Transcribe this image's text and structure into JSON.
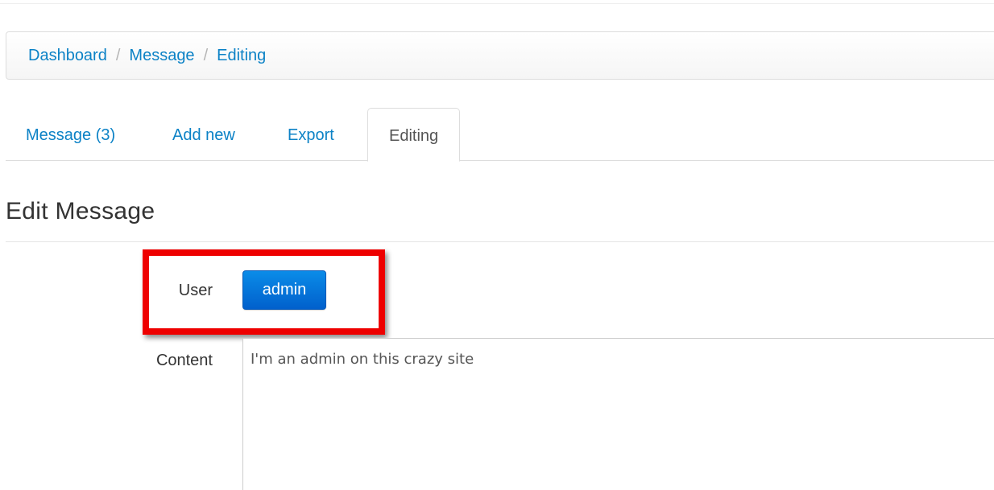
{
  "breadcrumb": {
    "items": [
      "Dashboard",
      "Message",
      "Editing"
    ],
    "separator": "/"
  },
  "tabs": [
    {
      "label": "Message (3)",
      "active": false
    },
    {
      "label": "Add new",
      "active": false
    },
    {
      "label": "Export",
      "active": false
    },
    {
      "label": "Editing",
      "active": true
    }
  ],
  "page_title": "Edit Message",
  "form": {
    "user": {
      "label": "User",
      "value": "admin"
    },
    "content": {
      "label": "Content",
      "value": "I'm an admin on this crazy site"
    }
  },
  "colors": {
    "link": "#0c82c6",
    "primary_button": "#0160cc",
    "highlight": "#ee0000"
  }
}
